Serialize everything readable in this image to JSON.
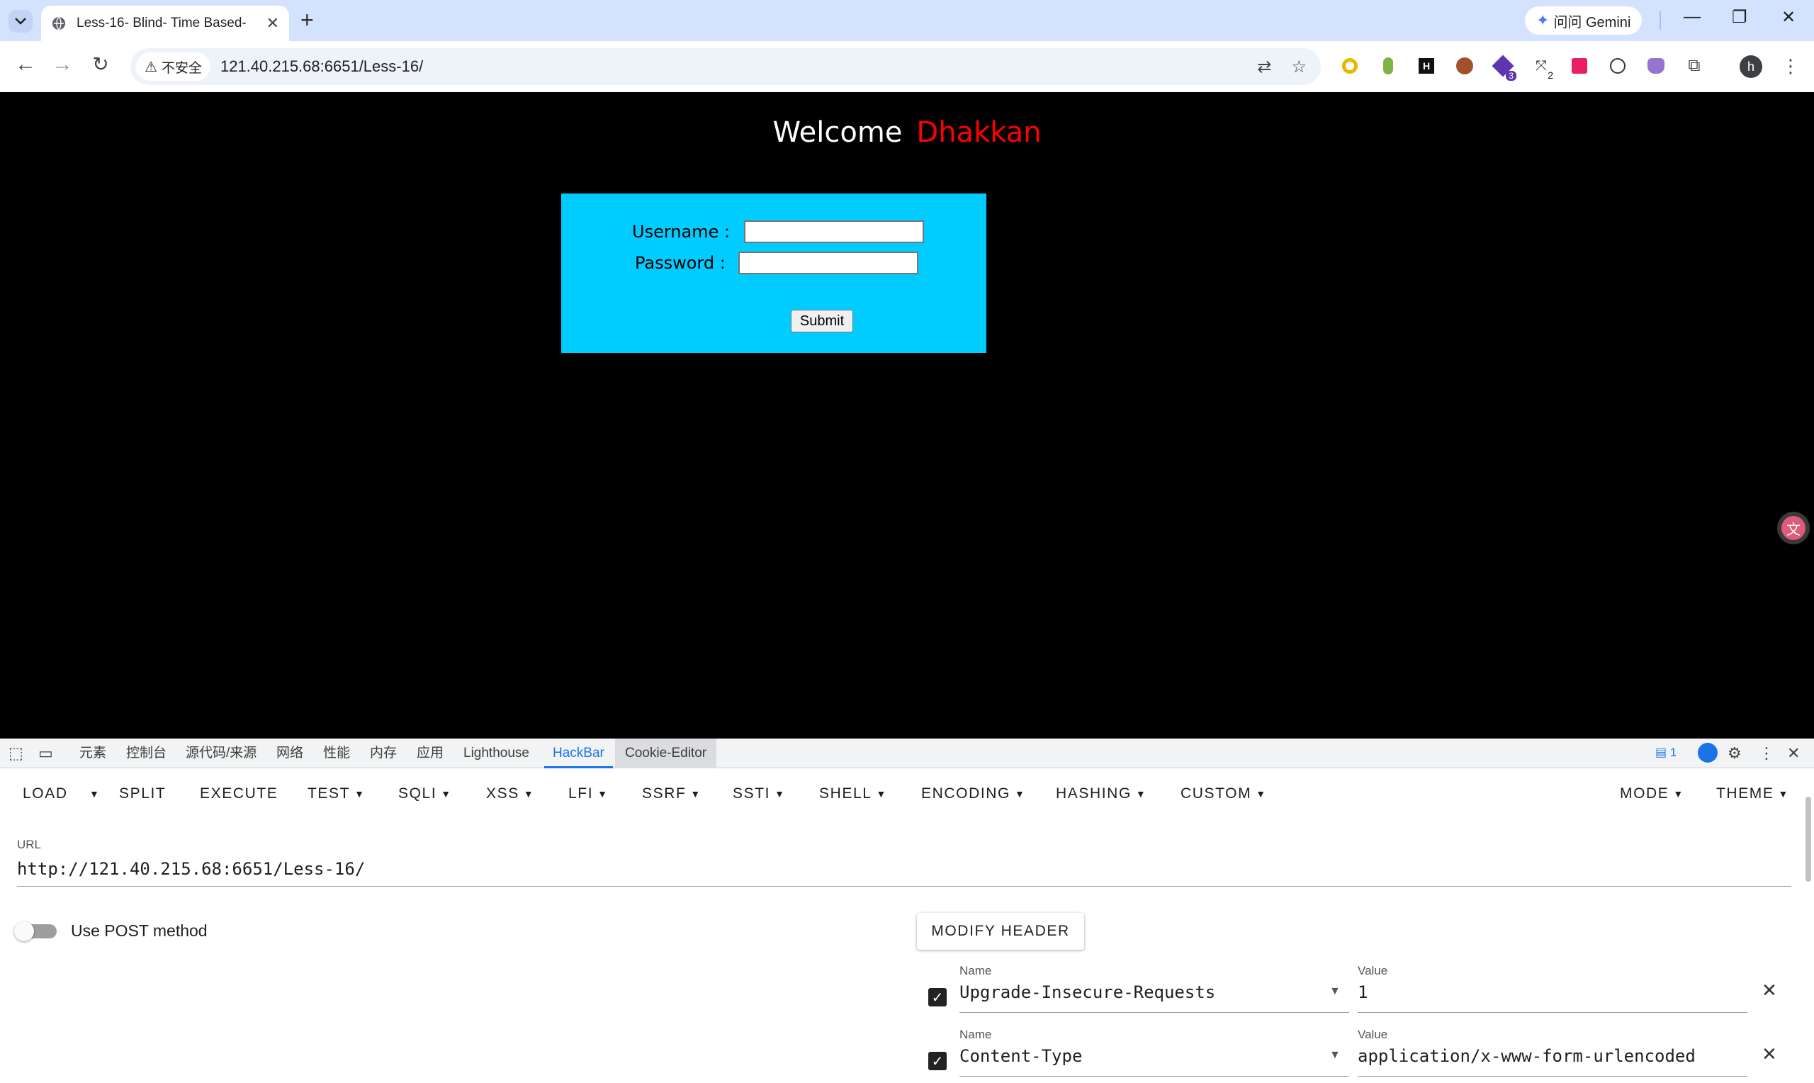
{
  "browser": {
    "tab_title": "Less-16- Blind- Time Based- ",
    "gemini_label": "问问 Gemini",
    "security_chip": "不安全",
    "address": "121.40.215.68:6651/Less-16/",
    "extension_badge_3": "3",
    "extension_badge_2": "2",
    "profile_initial": "h"
  },
  "page": {
    "welcome": "Welcome",
    "user": "Dhakkan",
    "username_label": "Username :",
    "password_label": "Password :",
    "submit_label": "Submit"
  },
  "devtools": {
    "tabs": [
      "元素",
      "控制台",
      "源代码/来源",
      "网络",
      "性能",
      "内存",
      "应用",
      "Lighthouse",
      "HackBar",
      "Cookie-Editor"
    ],
    "active_tab": "HackBar",
    "issues_count": "1"
  },
  "hackbar": {
    "menu": {
      "load": "LOAD",
      "split": "SPLIT",
      "execute": "EXECUTE",
      "test": "TEST",
      "sqli": "SQLI",
      "xss": "XSS",
      "lfi": "LFI",
      "ssrf": "SSRF",
      "ssti": "SSTI",
      "shell": "SHELL",
      "encoding": "ENCODING",
      "hashing": "HASHING",
      "custom": "CUSTOM",
      "mode": "MODE",
      "theme": "THEME"
    },
    "url_label": "URL",
    "url_value": "http://121.40.215.68:6651/Less-16/",
    "post_label": "Use POST method",
    "post_enabled": false,
    "modify_header_label": "MODIFY HEADER",
    "headers": [
      {
        "name_label": "Name",
        "name": "Upgrade-Insecure-Requests",
        "value_label": "Value",
        "value": "1",
        "enabled": true
      },
      {
        "name_label": "Name",
        "name": "Content-Type",
        "value_label": "Value",
        "value": "application/x-www-form-urlencoded",
        "enabled": true
      }
    ]
  },
  "colors": {
    "login_box": "#00ccff",
    "user_highlight": "#ff0000",
    "devtools_accent": "#1a73e8"
  }
}
